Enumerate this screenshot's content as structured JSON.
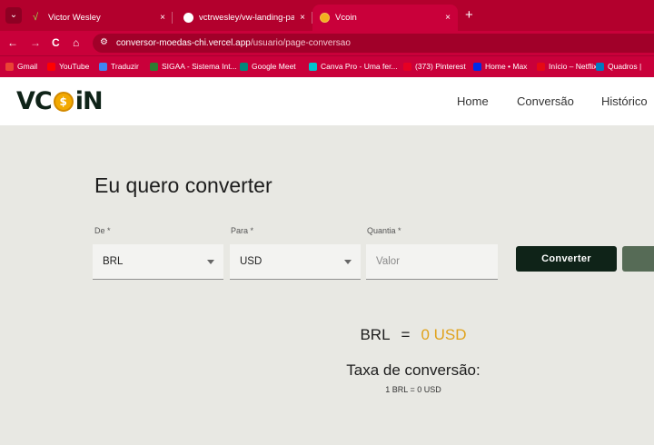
{
  "browser": {
    "tabs": [
      {
        "title": "Victor Wesley",
        "favicon": "victor-icon",
        "active": false
      },
      {
        "title": "vctrwesley/vw-landing-page-p",
        "favicon": "github-icon",
        "active": false
      },
      {
        "title": "Vcoin",
        "favicon": "vcoin-icon",
        "active": true
      }
    ],
    "tab_menu_glyph": "⌄",
    "close_glyph": "×",
    "new_tab_glyph": "+",
    "nav": {
      "back": "←",
      "forward": "→",
      "reload": "C",
      "home": "⌂"
    },
    "url": {
      "domain": "conversor-moedas-chi.vercel.app",
      "path": "/usuario/page-conversao"
    },
    "bookmarks": [
      {
        "label": "Gmail",
        "color": "#ea4335"
      },
      {
        "label": "YouTube",
        "color": "#ff0000"
      },
      {
        "label": "Traduzir",
        "color": "#4285f4"
      },
      {
        "label": "SIGAA - Sistema Int...",
        "color": "#2e7d32"
      },
      {
        "label": "Google Meet",
        "color": "#00897b"
      },
      {
        "label": "Canva Pro - Uma fer...",
        "color": "#00c4cc"
      },
      {
        "label": "(373) Pinterest",
        "color": "#e60023"
      },
      {
        "label": "Home • Max",
        "color": "#002be7"
      },
      {
        "label": "Início – Netflix",
        "color": "#e50914"
      },
      {
        "label": "Quadros |",
        "color": "#0079bf"
      }
    ]
  },
  "site": {
    "logo": {
      "part1": "VC",
      "coin": "$",
      "part2": "iN"
    },
    "menu": [
      "Home",
      "Conversão",
      "Histórico"
    ]
  },
  "converter": {
    "title": "Eu quero converter",
    "from": {
      "label": "De *",
      "value": "BRL"
    },
    "to": {
      "label": "Para *",
      "value": "USD"
    },
    "amount": {
      "label": "Quantia *",
      "placeholder": "Valor"
    },
    "convert_button": "Converter"
  },
  "result": {
    "from_currency": "BRL",
    "equals": "=",
    "amount_text": "0 USD",
    "rate_title": "Taxa de conversão:",
    "rate_value": "1 BRL = 0 USD"
  },
  "colors": {
    "accent": "#e0a21c",
    "dark": "#0f2318",
    "browser": "#c9003a"
  }
}
